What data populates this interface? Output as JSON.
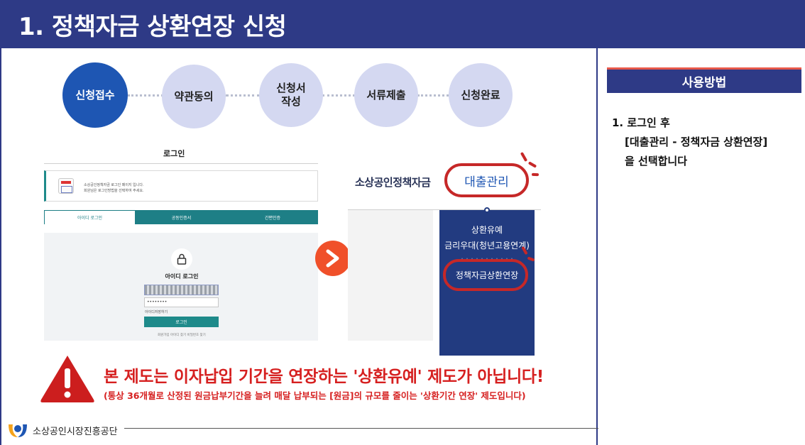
{
  "header": {
    "title": "1. 정책자금 상환연장 신청"
  },
  "steps": [
    {
      "label": "신청접수",
      "active": true
    },
    {
      "label": "약관동의",
      "active": false
    },
    {
      "label": "신청서\n작성",
      "active": false
    },
    {
      "label": "서류제출",
      "active": false
    },
    {
      "label": "신청완료",
      "active": false
    }
  ],
  "login_screen": {
    "title": "로그인",
    "notice_line1": "소상공인정책자금 로그인 페이지 입니다.",
    "notice_line2": "회원님은 로그인방법을 선택하여 주세요.",
    "tabs": [
      "아이디 로그인",
      "공동인증서",
      "간편인증"
    ],
    "heading": "아이디 로그인",
    "password_mask": "••••••••",
    "save_id": "아이디저장하기",
    "login_button": "로그인",
    "find_links": "회원가입  아이디 찾기  비밀번호 찾기"
  },
  "menu_screen": {
    "brand": "소상공인정책자금",
    "menu_label": "대출관리",
    "dropdown_items": [
      "상환유예",
      "금리우대(청년고용연계)",
      "정책자금상환연장"
    ]
  },
  "warning": {
    "main": "본 제도는 이자납입 기간을 연장하는 '상환유예' 제도가 아닙니다!",
    "sub": "(통상 36개월로 산정된 원금납부기간을 늘려 매달 납부되는 [원금]의 규모를 줄이는 '상환기간 연장' 제도입니다)"
  },
  "footer": {
    "org": "소상공인시장진흥공단"
  },
  "usage": {
    "title": "사용방법",
    "line1": "1. 로그인 후",
    "line2": "[대출관리 - 정책자금 상환연장]",
    "line3": "을 선택합니다"
  },
  "colors": {
    "header": "#2e3a86",
    "active_step": "#1e56b3",
    "warning": "#d62020",
    "arrow": "#f0502a"
  }
}
